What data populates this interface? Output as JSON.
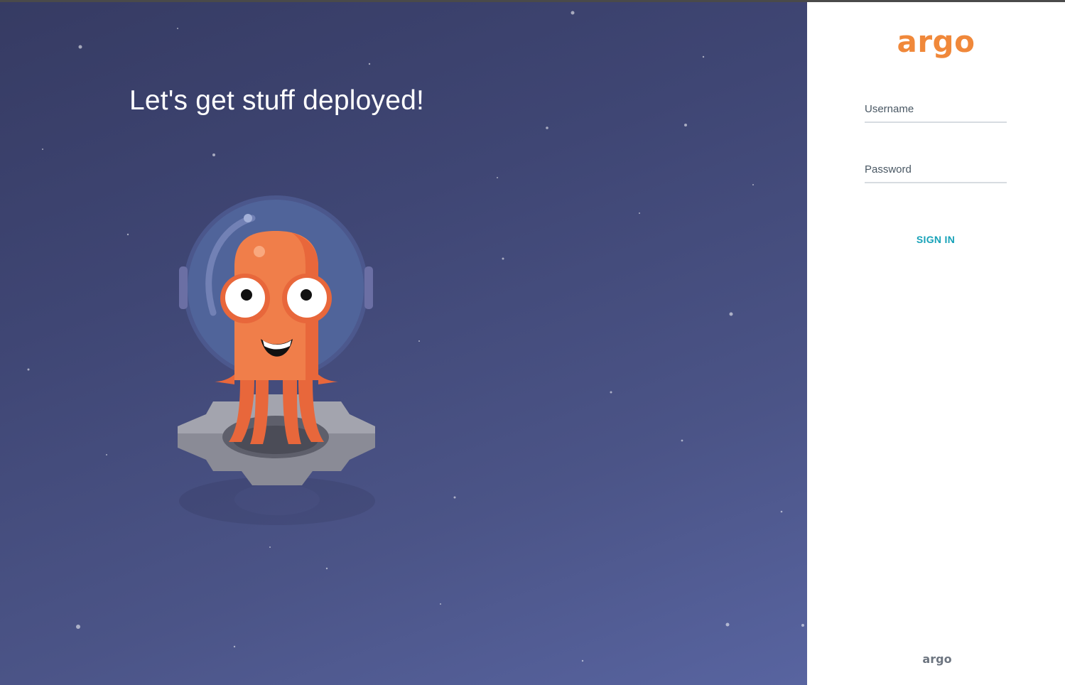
{
  "hero": {
    "title": "Let's get stuff deployed!",
    "illustration": "argo-octopus-astronaut-icon"
  },
  "login": {
    "logo_text": "argo",
    "username_placeholder": "Username",
    "password_placeholder": "Password",
    "signin_label": "SIGN IN",
    "footer_logo_text": "argo"
  },
  "colors": {
    "brand_orange": "#f0883a",
    "signin_teal": "#17a2b8",
    "hero_bg_top": "#363b63",
    "hero_bg_bottom": "#5864a0",
    "field_underline": "#d7dce1"
  }
}
